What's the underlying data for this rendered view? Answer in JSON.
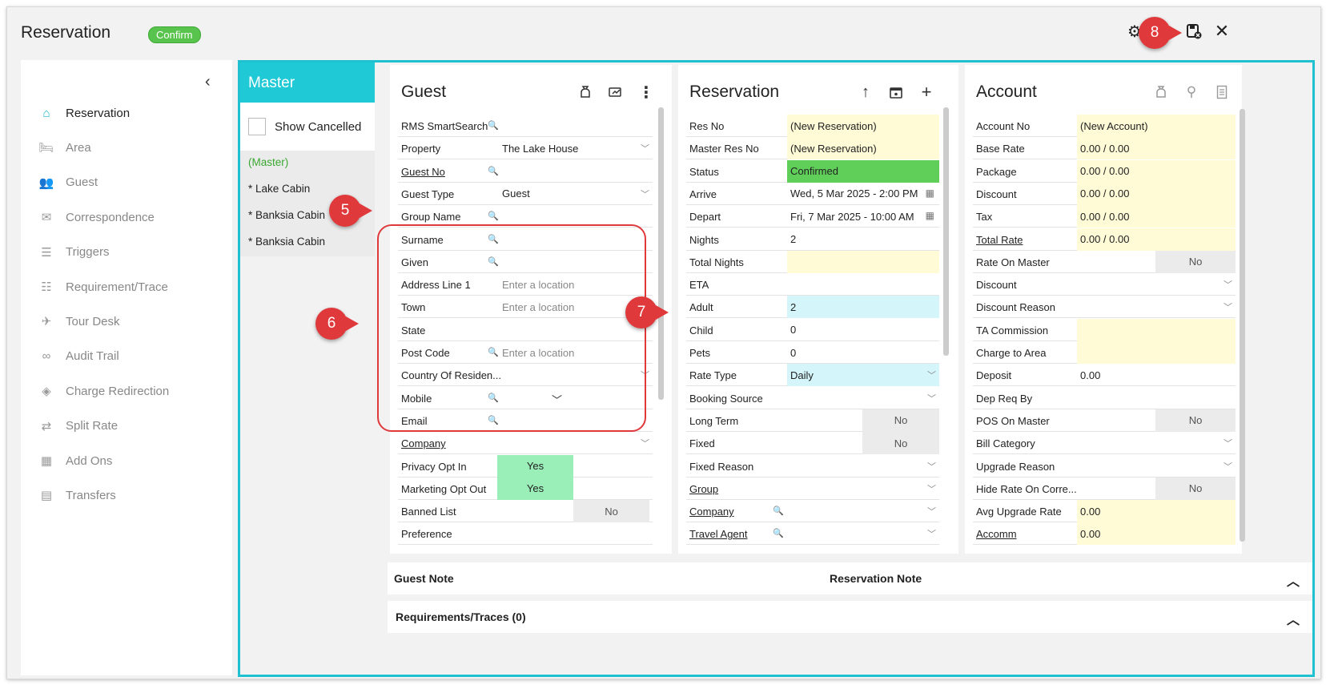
{
  "window": {
    "title": "Reservation",
    "badge": "Confirm"
  },
  "sidebar": {
    "items": [
      {
        "label": "Reservation",
        "icon": "home-icon",
        "active": true
      },
      {
        "label": "Area",
        "icon": "bed-icon"
      },
      {
        "label": "Guest",
        "icon": "users-icon"
      },
      {
        "label": "Correspondence",
        "icon": "mail-icon"
      },
      {
        "label": "Triggers",
        "icon": "list-icon"
      },
      {
        "label": "Requirement/Trace",
        "icon": "checklist-icon"
      },
      {
        "label": "Tour Desk",
        "icon": "plane-icon"
      },
      {
        "label": "Audit Trail",
        "icon": "glasses-icon"
      },
      {
        "label": "Charge Redirection",
        "icon": "diamond-icon"
      },
      {
        "label": "Split Rate",
        "icon": "split-icon"
      },
      {
        "label": "Add Ons",
        "icon": "grid-icon"
      },
      {
        "label": "Transfers",
        "icon": "bus-icon"
      }
    ]
  },
  "master": {
    "title": "Master",
    "show_cancelled": "Show Cancelled",
    "items": [
      "(Master)",
      "* Lake Cabin",
      "* Banksia Cabin",
      "* Banksia Cabin"
    ]
  },
  "guest": {
    "title": "Guest",
    "rows": [
      {
        "label": "RMS SmartSearch",
        "value": ""
      },
      {
        "label": "Property",
        "value": "The Lake House"
      },
      {
        "label": "Guest No",
        "value": ""
      },
      {
        "label": "Guest Type",
        "value": "Guest"
      },
      {
        "label": "Group Name",
        "value": ""
      },
      {
        "label": "Surname",
        "value": ""
      },
      {
        "label": "Given",
        "value": ""
      },
      {
        "label": "Address Line 1",
        "value": "Enter a location"
      },
      {
        "label": "Town",
        "value": "Enter a location"
      },
      {
        "label": "State",
        "value": ""
      },
      {
        "label": "Post Code",
        "value": "Enter a location"
      },
      {
        "label": "Country Of Residen...",
        "value": ""
      },
      {
        "label": "Mobile",
        "value": ""
      },
      {
        "label": "Email",
        "value": ""
      },
      {
        "label": "Company",
        "value": ""
      },
      {
        "label": "Privacy Opt In",
        "value": "Yes"
      },
      {
        "label": "Marketing Opt Out",
        "value": "Yes"
      },
      {
        "label": "Banned List",
        "value": "No"
      },
      {
        "label": "Preference",
        "value": ""
      }
    ]
  },
  "reservation": {
    "title": "Reservation",
    "rows": [
      {
        "label": "Res No",
        "value": "(New Reservation)"
      },
      {
        "label": "Master Res No",
        "value": "(New Reservation)"
      },
      {
        "label": "Status",
        "value": "Confirmed"
      },
      {
        "label": "Arrive",
        "value": "Wed, 5 Mar 2025 - 2:00 PM"
      },
      {
        "label": "Depart",
        "value": "Fri, 7 Mar 2025 - 10:00 AM"
      },
      {
        "label": "Nights",
        "value": "2"
      },
      {
        "label": "Total Nights",
        "value": ""
      },
      {
        "label": "ETA",
        "value": ""
      },
      {
        "label": "Adult",
        "value": "2"
      },
      {
        "label": "Child",
        "value": "0"
      },
      {
        "label": "Pets",
        "value": "0"
      },
      {
        "label": "Rate Type",
        "value": "Daily"
      },
      {
        "label": "Booking Source",
        "value": ""
      },
      {
        "label": "Long Term",
        "value": "No"
      },
      {
        "label": "Fixed",
        "value": "No"
      },
      {
        "label": "Fixed Reason",
        "value": ""
      },
      {
        "label": "Group",
        "value": ""
      },
      {
        "label": "Company",
        "value": ""
      },
      {
        "label": "Travel Agent",
        "value": ""
      }
    ]
  },
  "account": {
    "title": "Account",
    "rows": [
      {
        "label": "Account No",
        "value": "(New Account)"
      },
      {
        "label": "Base Rate",
        "value": "0.00 / 0.00"
      },
      {
        "label": "Package",
        "value": "0.00 / 0.00"
      },
      {
        "label": "Discount",
        "value": "0.00 / 0.00"
      },
      {
        "label": "Tax",
        "value": "0.00 / 0.00"
      },
      {
        "label": "Total Rate",
        "value": "0.00 / 0.00"
      },
      {
        "label": "Rate On Master",
        "value": "No"
      },
      {
        "label": "Discount",
        "value": ""
      },
      {
        "label": "Discount Reason",
        "value": ""
      },
      {
        "label": "TA Commission",
        "value": ""
      },
      {
        "label": "Charge to Area",
        "value": ""
      },
      {
        "label": "Deposit",
        "value": "0.00"
      },
      {
        "label": "Dep Req By",
        "value": ""
      },
      {
        "label": "POS On Master",
        "value": "No"
      },
      {
        "label": "Bill Category",
        "value": ""
      },
      {
        "label": "Upgrade Reason",
        "value": ""
      },
      {
        "label": "Hide Rate On Corre...",
        "value": "No"
      },
      {
        "label": "Avg Upgrade Rate",
        "value": "0.00"
      },
      {
        "label": "Accomm",
        "value": "0.00"
      }
    ]
  },
  "notes": {
    "guest_note": "Guest Note",
    "reservation_note": "Reservation Note",
    "requirements": "Requirements/Traces (0)"
  },
  "callouts": [
    "5",
    "6",
    "7",
    "8"
  ],
  "colors": {
    "accent": "#1fc0cf",
    "callout": "#e0393b",
    "confirmed": "#5fcf5a",
    "readonly": "#fffbd6"
  }
}
